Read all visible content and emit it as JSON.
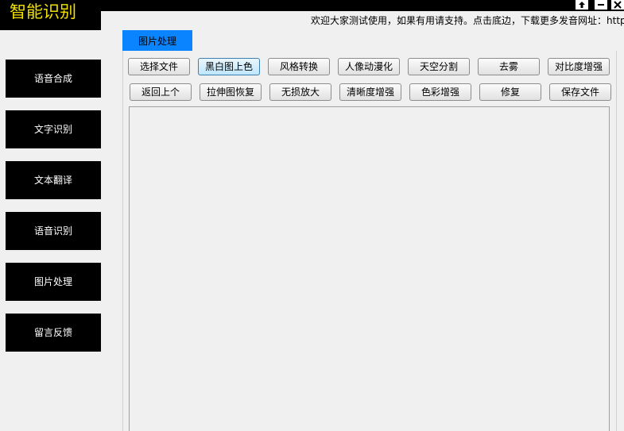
{
  "app": {
    "title": "智能识别"
  },
  "window_controls": {
    "pin_icon": "pin-icon",
    "minimize_icon": "minimize-icon",
    "close_icon": "close-icon"
  },
  "banner": {
    "text": "欢迎大家测试使用，如果有用请支持。点击底边，下载更多发音网址：http"
  },
  "tab": {
    "label": "图片处理"
  },
  "sidebar": {
    "items": [
      {
        "label": "语音合成"
      },
      {
        "label": "文字识别"
      },
      {
        "label": "文本翻译"
      },
      {
        "label": "语音识别"
      },
      {
        "label": "图片处理"
      },
      {
        "label": "留言反馈"
      }
    ]
  },
  "toolbar": {
    "row1": [
      {
        "label": "选择文件"
      },
      {
        "label": "黑白图上色"
      },
      {
        "label": "风格转换"
      },
      {
        "label": "人像动漫化"
      },
      {
        "label": "天空分割"
      },
      {
        "label": "去雾"
      },
      {
        "label": "对比度增强"
      }
    ],
    "row2": [
      {
        "label": "返回上个"
      },
      {
        "label": "拉伸图恢复"
      },
      {
        "label": "无损放大"
      },
      {
        "label": "清晰度增强"
      },
      {
        "label": "色彩增强"
      },
      {
        "label": "修复"
      },
      {
        "label": "保存文件"
      }
    ]
  },
  "colors": {
    "title_text": "#f0e000",
    "tab_accent": "#0a84ff",
    "sidebar_bg": "#000000"
  }
}
